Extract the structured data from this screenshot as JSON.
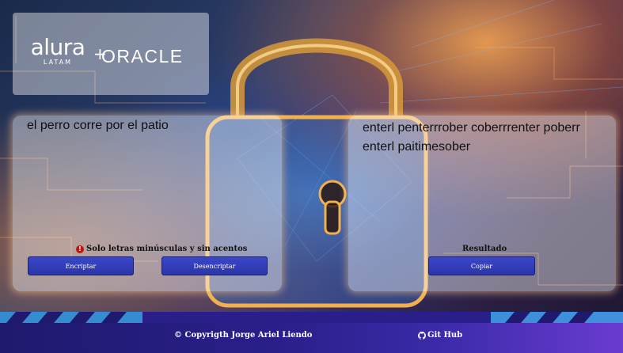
{
  "brand": {
    "logo_alura": "alura",
    "logo_alura_sub": "LATAM",
    "logo_plus": "+",
    "logo_oracle": "ORACLE"
  },
  "encrypt_panel": {
    "input_value": "el perro corre por el patio",
    "hint_icon": "!",
    "hint_text": "Solo letras minúsculas y sin acentos",
    "encrypt_label": "Encriptar",
    "decrypt_label": "Desencriptar"
  },
  "result_panel": {
    "output_text": "enterl penterrrober coberrrenter poberr enterl paitimesober",
    "result_label": "Resultado",
    "copy_label": "Copiar"
  },
  "footer": {
    "copyright": "© Copyrigth Jorge Ariel Liendo",
    "github_label": "Git Hub"
  },
  "colors": {
    "button": "#2b35a8",
    "footer": "#2a1f8a",
    "hint_icon": "#c21212"
  },
  "icons": {
    "hint": "alert-circle-icon",
    "github": "github-icon",
    "background": "padlock-illustration"
  }
}
